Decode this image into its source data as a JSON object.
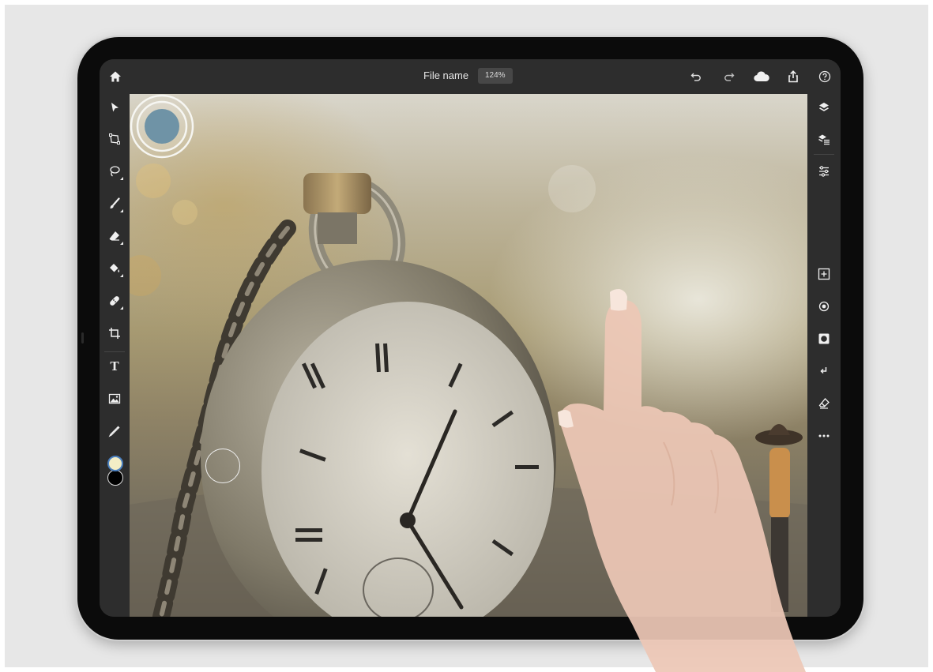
{
  "header": {
    "file_name": "File name",
    "zoom": "124%"
  },
  "icons": {
    "top_left": [
      "home-icon"
    ],
    "top_right": [
      "undo-icon",
      "redo-icon",
      "cloud-icon",
      "share-icon",
      "help-icon"
    ],
    "left_tools": [
      "select-icon",
      "transform-icon",
      "lasso-icon",
      "brush-icon",
      "eraser-icon",
      "fill-icon",
      "healing-icon",
      "crop-icon",
      "text-icon",
      "image-icon",
      "eyedropper-icon"
    ],
    "right_tools": [
      "layers-icon",
      "layer-properties-icon",
      "adjustments-icon",
      "add-layer-icon",
      "visibility-icon",
      "mask-icon",
      "clip-icon",
      "eraser-layer-icon",
      "more-icon"
    ]
  },
  "colors": {
    "foreground": "#f3edc6",
    "background": "#000000",
    "ui_dark": "#2d2d2d",
    "touch_point": "#6f93a6"
  },
  "text_tool_label": "T"
}
